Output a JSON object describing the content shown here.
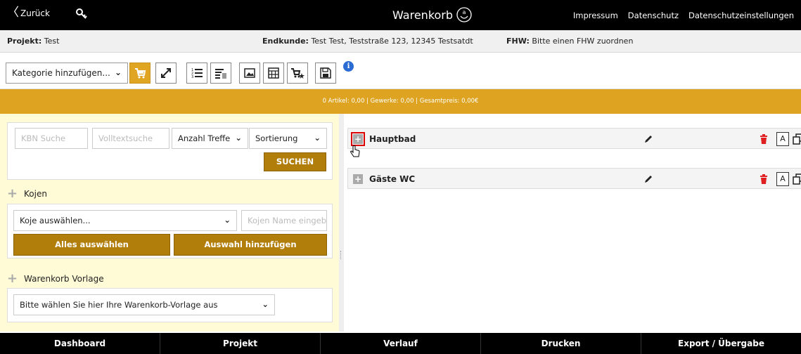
{
  "topbar": {
    "back_label": "Zurück",
    "title": "Warenkorb",
    "links": [
      "Impressum",
      "Datenschutz",
      "Datenschutzeinstellungen"
    ]
  },
  "infobar": {
    "project_label": "Projekt:",
    "project_value": "Test",
    "customer_label": "Endkunde:",
    "customer_value": "Test Test, Teststraße 123, 12345 Testsatdt",
    "fhw_label": "FHW:",
    "fhw_value": "Bitte einen FHW zuordnen"
  },
  "toolbar": {
    "category_select": "Kategorie hinzufügen...",
    "buttons": [
      "cart-icon",
      "expand-icon",
      "numbered-list-icon",
      "list-delete-icon",
      "image-icon",
      "calculator-icon",
      "cart-star-icon",
      "save-icon"
    ],
    "info_glyph": "i"
  },
  "summary": {
    "text": "0 Artikel: 0,00 | Gewerke: 0,00 | Gesamtpreis: 0,00€"
  },
  "search": {
    "kbn_placeholder": "KBN Suche",
    "fulltext_placeholder": "Volltextsuche",
    "hits_select": "Anzahl Treffe",
    "sort_select": "Sortierung",
    "search_button": "SUCHEN"
  },
  "kojen": {
    "heading": "Kojen",
    "select": "Koje auswählen...",
    "name_placeholder": "Kojen Name eingeb...",
    "select_all_button": "Alles auswählen",
    "add_selection_button": "Auswahl hinzufügen"
  },
  "vorlage": {
    "heading": "Warenkorb Vorlage",
    "select": "Bitte wählen Sie hier Ihre Warenkorb-Vorlage aus"
  },
  "rooms": [
    {
      "title": "Hauptbad",
      "a_label": "A"
    },
    {
      "title": "Gäste WC",
      "a_label": "A"
    }
  ],
  "bottomnav": [
    "Dashboard",
    "Projekt",
    "Verlauf",
    "Drucken",
    "Export / Übergabe"
  ],
  "colors": {
    "accent": "#dea421",
    "button_gold": "#b17d0b",
    "left_panel_bg": "#fffbd6",
    "delete_red": "#e02020"
  }
}
